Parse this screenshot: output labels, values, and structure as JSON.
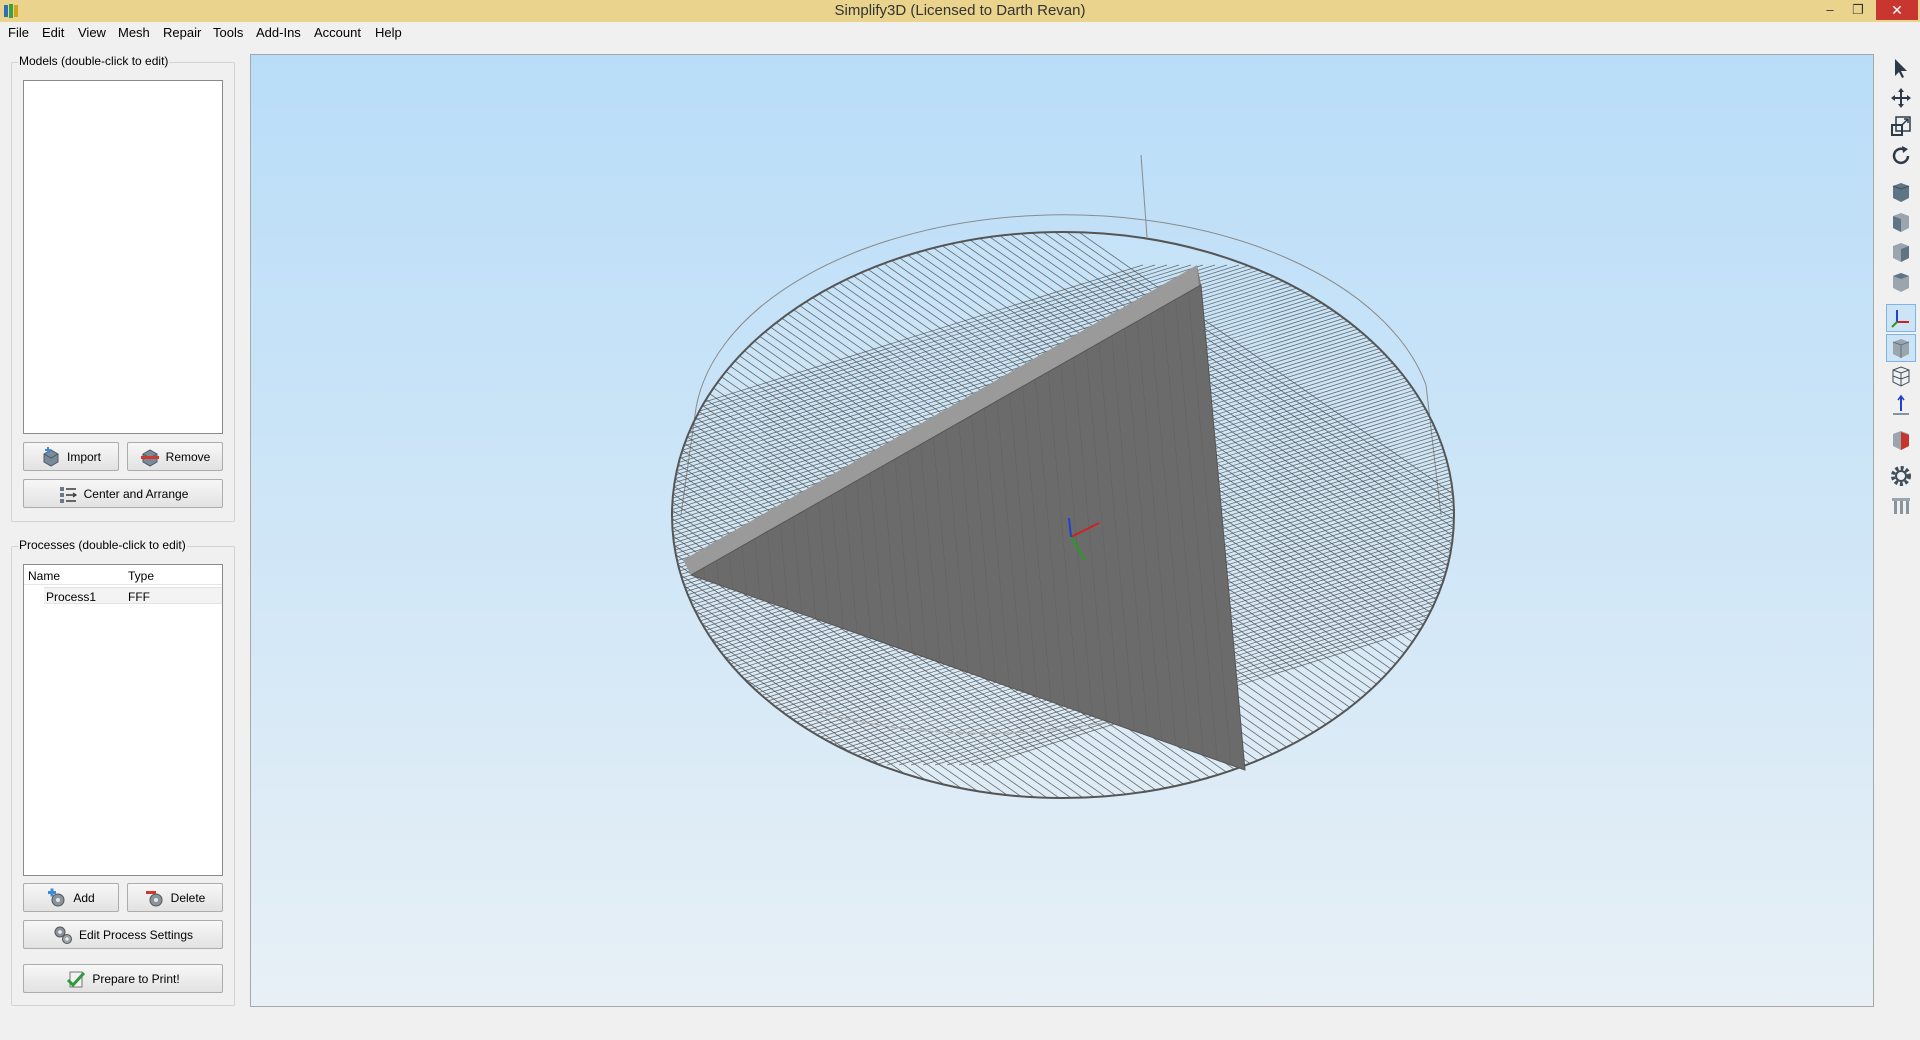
{
  "window": {
    "title": "Simplify3D (Licensed to Darth Revan)",
    "minimize": "–",
    "maximize": "❐",
    "close": "✕"
  },
  "menu": {
    "items": [
      "File",
      "Edit",
      "View",
      "Mesh",
      "Repair",
      "Tools",
      "Add-Ins",
      "Account",
      "Help"
    ]
  },
  "models": {
    "title": "Models (double-click to edit)",
    "import_label": "Import",
    "remove_label": "Remove",
    "center_label": "Center and Arrange"
  },
  "processes": {
    "title": "Processes (double-click to edit)",
    "columns": [
      "Name",
      "Type"
    ],
    "rows": [
      {
        "name": "Process1",
        "type": "FFF"
      }
    ],
    "add_label": "Add",
    "delete_label": "Delete",
    "edit_label": "Edit Process Settings",
    "prepare_label": "Prepare to Print!"
  },
  "toolbar": {
    "tools": [
      {
        "name": "select-tool-icon",
        "active": true
      },
      {
        "name": "move-tool-icon",
        "active": false
      },
      {
        "name": "scale-tool-icon",
        "active": false
      },
      {
        "name": "rotate-tool-icon",
        "active": false
      },
      {
        "name": "view-default-icon",
        "active": false
      },
      {
        "name": "view-front-icon",
        "active": false
      },
      {
        "name": "view-side-icon",
        "active": false
      },
      {
        "name": "view-top-icon",
        "active": false
      },
      {
        "name": "show-axes-icon",
        "active": true
      },
      {
        "name": "solid-view-icon",
        "active": true
      },
      {
        "name": "wireframe-view-icon",
        "active": false
      },
      {
        "name": "show-toolpath-icon",
        "active": false
      },
      {
        "name": "cross-section-icon",
        "active": false
      },
      {
        "name": "settings-icon",
        "active": false
      },
      {
        "name": "supports-icon",
        "active": false
      }
    ]
  },
  "colors": {
    "titlebar": "#e9d38d",
    "close": "#c7372f",
    "viewport_top": "#b9ddf8",
    "viewport_bottom": "#e8f0f6",
    "bed_grid": "#555555",
    "model": "#6b6b6b"
  }
}
